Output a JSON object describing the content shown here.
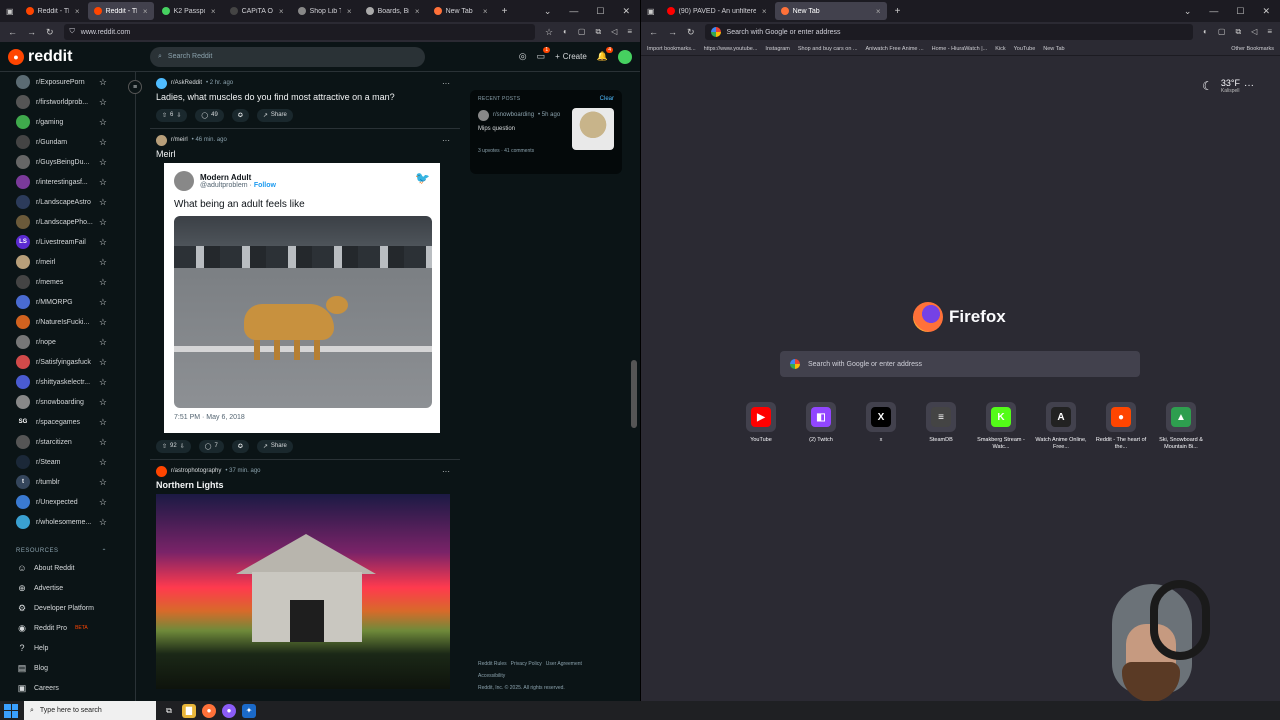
{
  "left_window": {
    "tabs": [
      {
        "label": "Reddit - The hear",
        "color": "#ff4500",
        "active": false
      },
      {
        "label": "Reddit - The h",
        "color": "#ff4500",
        "active": true
      },
      {
        "label": "K2 Passport Snow",
        "color": "#46d160",
        "active": false
      },
      {
        "label": "CAPiTA Outersp",
        "color": "#444444",
        "active": false
      },
      {
        "label": "Shop Lib Tech M",
        "color": "#888888",
        "active": false
      },
      {
        "label": "Boards, Bindings",
        "color": "#aaaaaa",
        "active": false
      },
      {
        "label": "New Tab",
        "color": "#ff7139",
        "active": false
      }
    ],
    "new_tab_symbol": "+",
    "url": "www.reddit.com"
  },
  "reddit": {
    "logo_text": "reddit",
    "search_placeholder": "Search Reddit",
    "create_label": "Create",
    "chat_badge": "1",
    "notif_badge": "4",
    "sidebar": [
      {
        "name": "r/ExposurePorn",
        "color": "#5b6b73",
        "initial": ""
      },
      {
        "name": "r/firstworldprob...",
        "color": "#555555",
        "initial": ""
      },
      {
        "name": "r/gaming",
        "color": "#3fa94c",
        "initial": ""
      },
      {
        "name": "r/Gundam",
        "color": "#444444",
        "initial": ""
      },
      {
        "name": "r/GuysBeingDu...",
        "color": "#666666",
        "initial": ""
      },
      {
        "name": "r/interestingasf...",
        "color": "#7a3a9a",
        "initial": ""
      },
      {
        "name": "r/LandscapeAstro",
        "color": "#2c3b5a",
        "initial": ""
      },
      {
        "name": "r/LandscapePho...",
        "color": "#6b5a3a",
        "initial": ""
      },
      {
        "name": "r/LivestreamFail",
        "color": "#5b2bd1",
        "initial": "LS"
      },
      {
        "name": "r/meirl",
        "color": "#b89f7a",
        "initial": ""
      },
      {
        "name": "r/memes",
        "color": "#444444",
        "initial": ""
      },
      {
        "name": "r/MMORPG",
        "color": "#4a6bd1",
        "initial": ""
      },
      {
        "name": "r/NatureIsFucki...",
        "color": "#d1621f",
        "initial": ""
      },
      {
        "name": "r/nope",
        "color": "#777777",
        "initial": ""
      },
      {
        "name": "r/Satisfyingasfuck",
        "color": "#d14a4a",
        "initial": ""
      },
      {
        "name": "r/shittyaskelectr...",
        "color": "#4a5bd1",
        "initial": ""
      },
      {
        "name": "r/snowboarding",
        "color": "#888888",
        "initial": ""
      },
      {
        "name": "r/spacegames",
        "color": "#0b1416",
        "initial": "SG"
      },
      {
        "name": "r/starcitizen",
        "color": "#555555",
        "initial": ""
      },
      {
        "name": "r/Steam",
        "color": "#1b2838",
        "initial": ""
      },
      {
        "name": "r/tumblr",
        "color": "#35465c",
        "initial": "t"
      },
      {
        "name": "r/Unexpected",
        "color": "#3a7ad1",
        "initial": ""
      },
      {
        "name": "r/wholesomeme...",
        "color": "#3aa0d1",
        "initial": ""
      }
    ],
    "resources_heading": "RESOURCES",
    "resources": [
      {
        "label": "About Reddit",
        "icon": "☺",
        "beta": ""
      },
      {
        "label": "Advertise",
        "icon": "⊕",
        "beta": ""
      },
      {
        "label": "Developer Platform",
        "icon": "⚙",
        "beta": ""
      },
      {
        "label": "Reddit Pro",
        "icon": "◉",
        "beta": "BETA"
      },
      {
        "label": "Help",
        "icon": "?",
        "beta": ""
      },
      {
        "label": "Blog",
        "icon": "▤",
        "beta": ""
      },
      {
        "label": "Careers",
        "icon": "▣",
        "beta": ""
      }
    ],
    "posts": {
      "p1": {
        "sub": "r/AskReddit",
        "time": "• 2 hr. ago",
        "title": "Ladies, what muscles do you find most attractive on a man?",
        "votes": "6",
        "comments": "49",
        "share": "Share"
      },
      "p2": {
        "sub": "r/meirl",
        "time": "• 46 min. ago",
        "title": "Meirl",
        "votes": "92",
        "comments": "7",
        "share": "Share",
        "tweet": {
          "name": "Modern Adult",
          "handle": "@adultproblem",
          "follow": "Follow",
          "text": "What being an adult feels like",
          "time": "7:51 PM · May 6, 2018"
        }
      },
      "p3": {
        "sub": "r/astrophotography",
        "time": "• 37 min. ago",
        "title": "Northern Lights"
      }
    },
    "recent": {
      "heading": "RECENT POSTS",
      "clear": "Clear",
      "sub": "r/snowboarding",
      "time": "• 5h ago",
      "title": "Mips question",
      "stats": "3 upvotes · 41 comments"
    },
    "footer": {
      "links": [
        "Reddit Rules",
        "Privacy Policy",
        "User Agreement"
      ],
      "accessibility": "Accessibility",
      "copyright": "Reddit, Inc. © 2025. All rights reserved."
    }
  },
  "right_window": {
    "tabs": [
      {
        "label": "(90) PAVED - An unfiltered snow",
        "color": "#ff0000",
        "active": false
      },
      {
        "label": "New Tab",
        "color": "#ff7139",
        "active": true
      }
    ],
    "url_placeholder": "Search with Google or enter address",
    "bookmarks": [
      "Import bookmarks...",
      "https://www.youtube...",
      "Instagram",
      "Shop and buy cars on ...",
      "Aniwatch Free Anime ...",
      "Home - HiuraWatch |...",
      "Kick",
      "YouTube",
      "New Tab"
    ],
    "other_bookmarks": "Other Bookmarks",
    "weather": {
      "temp": "33°F",
      "city": "Kalispell"
    },
    "brand": "Firefox",
    "search_placeholder": "Search with Google or enter address",
    "tiles": [
      {
        "label": "YouTube",
        "glyph": "▶",
        "color": "#ff0000"
      },
      {
        "label": "(2) Twitch",
        "glyph": "◧",
        "color": "#9146ff"
      },
      {
        "label": "x",
        "glyph": "X",
        "color": "#000000"
      },
      {
        "label": "SteamDB",
        "glyph": "≡",
        "color": "#444444"
      },
      {
        "label": "Smakberg Stream - Watc...",
        "glyph": "K",
        "color": "#53fc18"
      },
      {
        "label": "Watch Anime Online, Free...",
        "glyph": "A",
        "color": "#222222"
      },
      {
        "label": "Reddit - The heart of the...",
        "glyph": "●",
        "color": "#ff4500"
      },
      {
        "label": "Ski, Snowboard & Mountain Bi...",
        "glyph": "▲",
        "color": "#2e9e4f"
      }
    ]
  },
  "taskbar": {
    "search_placeholder": "Type here to search"
  }
}
